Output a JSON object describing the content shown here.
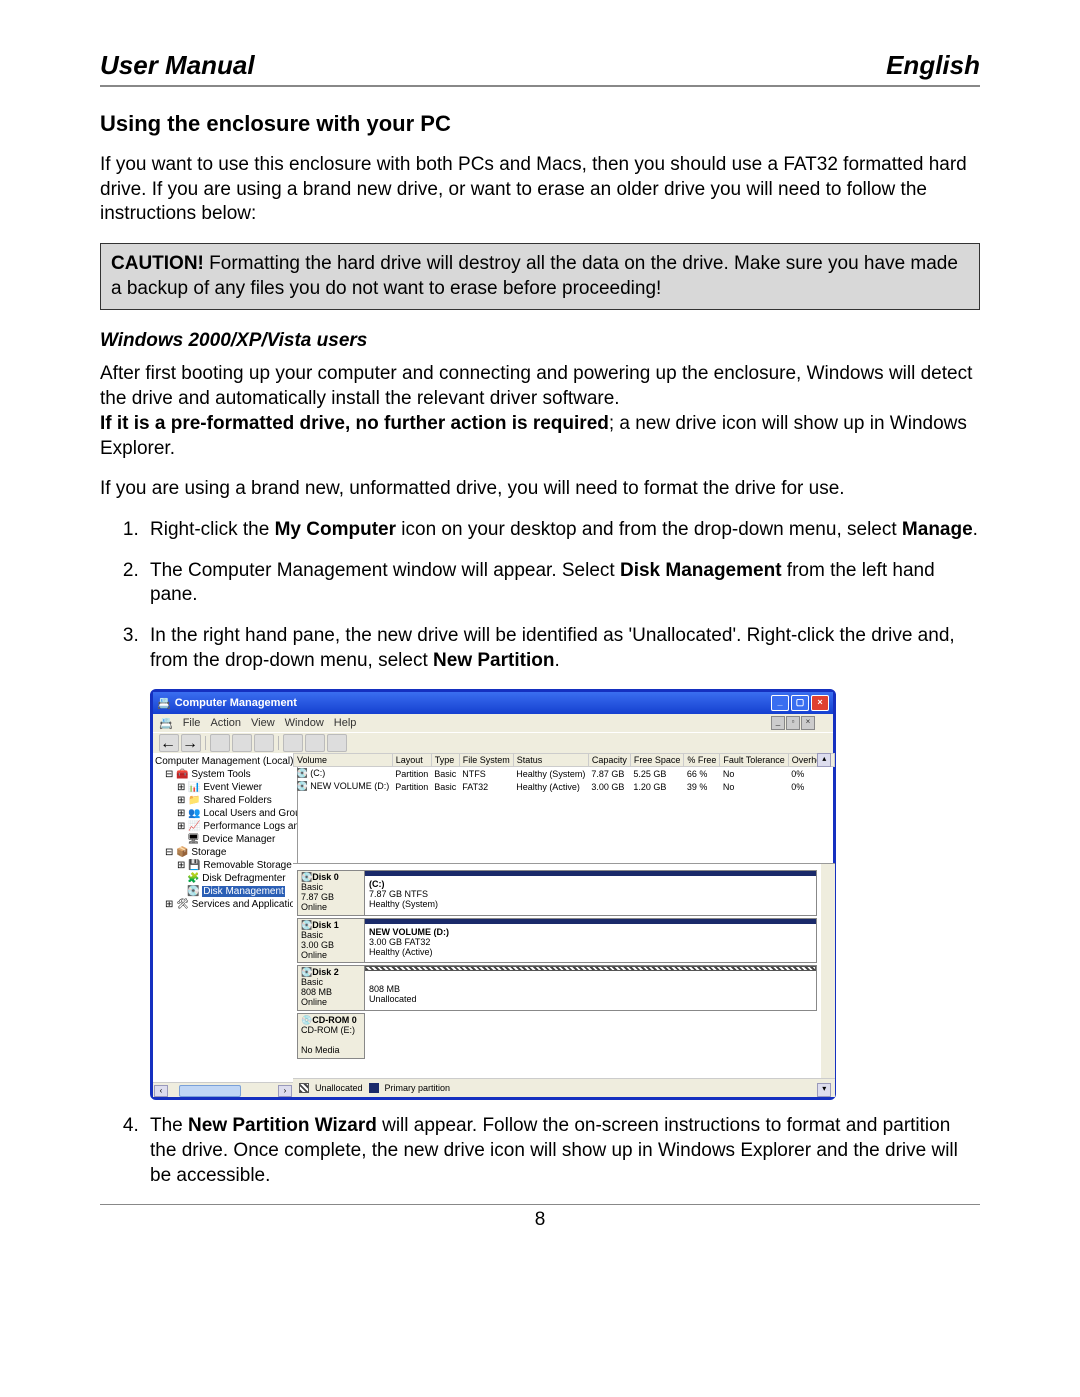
{
  "header": {
    "left": "User Manual",
    "right": "English"
  },
  "section_title": "Using the enclosure with your PC",
  "intro_para": "If you want to use this enclosure with both PCs and Macs, then you should use a FAT32 formatted hard drive. If you are using a brand new drive, or want to erase an older drive you will need to follow the instructions below:",
  "caution": {
    "label": "CAUTION!",
    "text": " Formatting the hard drive will destroy all the data on the drive. Make sure you have made a backup of any files you do not want to erase before proceeding!"
  },
  "subhead": "Windows 2000/XP/Vista users",
  "para2a": "After first booting up your computer and connecting and powering up the enclosure, Windows will detect the drive and automatically install the relevant driver software.",
  "para2b_bold": "If it is a pre-formatted drive, no further action is required",
  "para2b_rest": "; a new drive icon will show up in Windows Explorer.",
  "para3": "If you are using a brand new, unformatted drive, you will need to format the drive for use.",
  "step1_a": "Right-click the ",
  "step1_b": "My Computer",
  "step1_c": " icon on your desktop and from the drop-down menu, select ",
  "step1_d": "Manage",
  "step1_e": ".",
  "step2_a": "The Computer Management window will appear. Select ",
  "step2_b": "Disk Management",
  "step2_c": " from the left hand pane.",
  "step3_a": "In the right hand pane, the new drive will be identified as 'Unallocated'. Right-click the drive and, from the drop-down menu, select ",
  "step3_b": "New Partition",
  "step3_c": ".",
  "step4_a": "The ",
  "step4_b": "New Partition Wizard",
  "step4_c": " will appear. Follow the on-screen instructions to format and partition the drive. Once complete, the new drive icon will show up in Windows Explorer and the drive will be accessible.",
  "page_number": "8",
  "screenshot": {
    "window_title": "Computer Management",
    "menu": {
      "file": "File",
      "action": "Action",
      "view": "View",
      "window": "Window",
      "help": "Help"
    },
    "tree": {
      "root": "Computer Management (Local)",
      "system_tools": "System Tools",
      "event_viewer": "Event Viewer",
      "shared_folders": "Shared Folders",
      "local_users": "Local Users and Groups",
      "perf_logs": "Performance Logs and Alerts",
      "device_mgr": "Device Manager",
      "storage": "Storage",
      "removable": "Removable Storage",
      "defrag": "Disk Defragmenter",
      "disk_mgmt": "Disk Management",
      "services": "Services and Applications"
    },
    "table": {
      "headers": {
        "volume": "Volume",
        "layout": "Layout",
        "type": "Type",
        "fs": "File System",
        "status": "Status",
        "capacity": "Capacity",
        "free": "Free Space",
        "pct": "% Free",
        "fault": "Fault Tolerance",
        "overhead": "Overhead"
      },
      "rows": [
        {
          "volume": "(C:)",
          "layout": "Partition",
          "type": "Basic",
          "fs": "NTFS",
          "status": "Healthy (System)",
          "capacity": "7.87 GB",
          "free": "5.25 GB",
          "pct": "66 %",
          "fault": "No",
          "overhead": "0%"
        },
        {
          "volume": "NEW VOLUME (D:)",
          "layout": "Partition",
          "type": "Basic",
          "fs": "FAT32",
          "status": "Healthy (Active)",
          "capacity": "3.00 GB",
          "free": "1.20 GB",
          "pct": "39 %",
          "fault": "No",
          "overhead": "0%"
        }
      ]
    },
    "disks": {
      "d0": {
        "name": "Disk 0",
        "type": "Basic",
        "size": "7.87 GB",
        "status": "Online",
        "part_title": "(C:)",
        "part_line2": "7.87 GB NTFS",
        "part_line3": "Healthy (System)"
      },
      "d1": {
        "name": "Disk 1",
        "type": "Basic",
        "size": "3.00 GB",
        "status": "Online",
        "part_title": "NEW VOLUME  (D:)",
        "part_line2": "3.00 GB FAT32",
        "part_line3": "Healthy (Active)"
      },
      "d2": {
        "name": "Disk 2",
        "type": "Basic",
        "size": "808 MB",
        "status": "Online",
        "part_title": "",
        "part_line2": "808 MB",
        "part_line3": "Unallocated"
      },
      "cd": {
        "name": "CD-ROM 0",
        "line2": "CD-ROM (E:)",
        "status": "No Media"
      }
    },
    "legend": {
      "unallocated": "Unallocated",
      "primary": "Primary partition"
    }
  }
}
